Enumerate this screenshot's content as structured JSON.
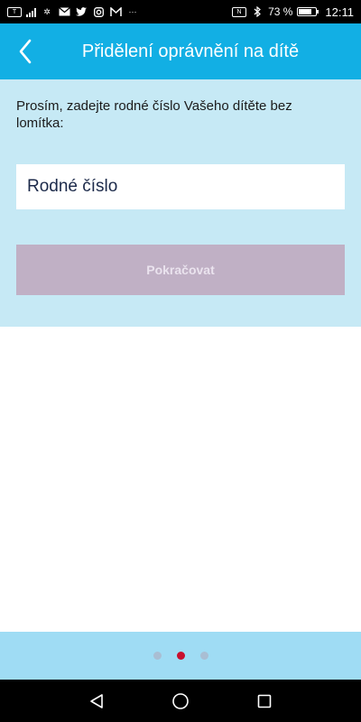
{
  "status_bar": {
    "battery_percent": "73 %",
    "battery_level": 0.73,
    "time": "12:11",
    "left_icons": [
      "tmobile-icon",
      "signal-icon",
      "settings-icon",
      "mail-icon",
      "twitter-icon",
      "instagram-icon",
      "gmail-icon",
      "more-icon"
    ],
    "right_icons": [
      "nfc-icon",
      "bluetooth-icon",
      "battery-icon"
    ]
  },
  "header": {
    "title": "Přidělení oprávnění na dítě",
    "back_icon": "chevron-left-icon"
  },
  "form": {
    "prompt": "Prosím, zadejte rodné číslo Vašeho dítěte bez lomítka:",
    "input_placeholder": "Rodné číslo",
    "input_value": "",
    "continue_label": "Pokračovat"
  },
  "pager": {
    "pages": 3,
    "active_index": 1
  },
  "colors": {
    "app_bar": "#12afe4",
    "panel": "#c6e9f5",
    "button_disabled": "#c0b0c5",
    "pager_bg": "#9fdcf4",
    "active_dot": "#c8102e",
    "inactive_dot": "#a9bed3"
  },
  "nav_bar": {
    "buttons": [
      "back-triangle-icon",
      "home-circle-icon",
      "recents-square-icon"
    ]
  }
}
